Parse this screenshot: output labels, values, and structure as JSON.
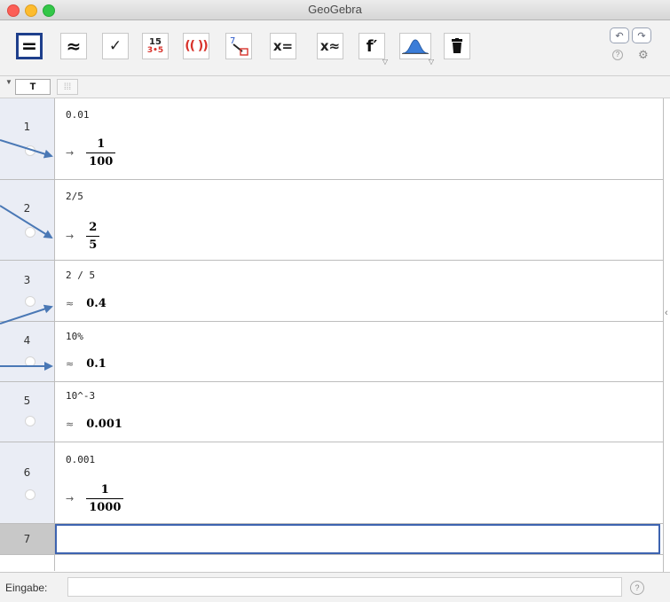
{
  "window": {
    "title": "GeoGebra"
  },
  "toolbar": {
    "tools": [
      {
        "name": "evaluate-tool",
        "label": "="
      },
      {
        "name": "numeric-tool",
        "label": "≈"
      },
      {
        "name": "keep-input-tool",
        "label": "✓"
      },
      {
        "name": "factor-tool",
        "label_top": "15",
        "label_bottom": "3•5"
      },
      {
        "name": "expand-tool",
        "label": "(( ))"
      },
      {
        "name": "substitute-tool",
        "label": "7"
      },
      {
        "name": "solve-tool",
        "label": "x="
      },
      {
        "name": "solve-numerically-tool",
        "label": "x≈"
      },
      {
        "name": "derivative-tool",
        "label": "f′"
      },
      {
        "name": "probability-tool",
        "label": ""
      },
      {
        "name": "delete-tool",
        "label": ""
      }
    ],
    "undo": "↶",
    "redo": "↷",
    "help": "?",
    "settings": "⚙"
  },
  "subbar": {
    "text_style_button": "T",
    "table_button": "⁞⁞⁞"
  },
  "cas_rows": [
    {
      "number": "1",
      "input": "0.01",
      "output_symbol": "→",
      "output_type": "fraction",
      "numerator": "1",
      "denominator": "100"
    },
    {
      "number": "2",
      "input": "2/5",
      "output_symbol": "→",
      "output_type": "fraction",
      "numerator": "2",
      "denominator": "5"
    },
    {
      "number": "3",
      "input": "2 / 5",
      "output_symbol": "≈",
      "output_type": "decimal",
      "value": "0.4"
    },
    {
      "number": "4",
      "input": "10%",
      "output_symbol": "≈",
      "output_type": "decimal",
      "value": "0.1"
    },
    {
      "number": "5",
      "input": "10^-3",
      "output_symbol": "≈",
      "output_type": "decimal",
      "value": "0.001"
    },
    {
      "number": "6",
      "input": "0.001",
      "output_symbol": "→",
      "output_type": "fraction",
      "numerator": "1",
      "denominator": "1000"
    },
    {
      "number": "7",
      "input": ""
    }
  ],
  "inputbar": {
    "label": "Eingabe:",
    "value": "",
    "help": "?"
  },
  "colors": {
    "accent": "#1e3f8c",
    "arrow": "#4a78b5",
    "row_header": "#eaedf5",
    "active_row_header": "#c8c8c8"
  }
}
